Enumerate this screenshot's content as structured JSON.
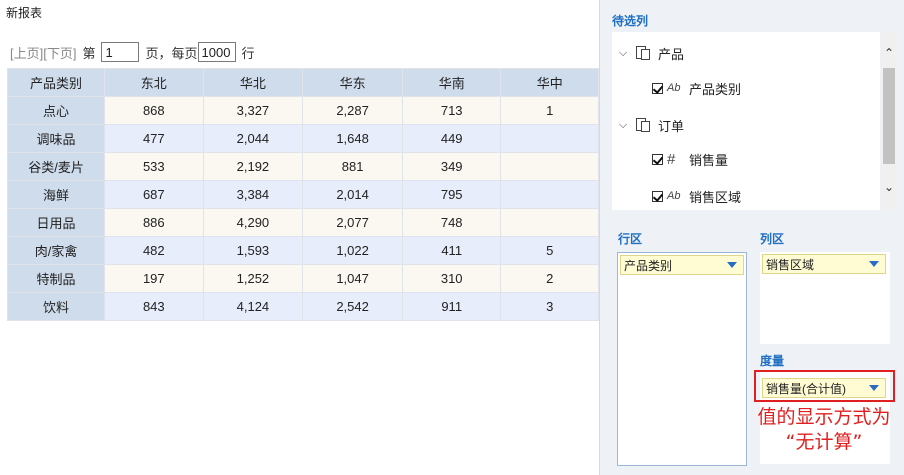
{
  "report": {
    "title": "新报表",
    "pager": {
      "prev": "[上页]",
      "next": "[下页]",
      "page_prefix": "第",
      "page_value": "1",
      "page_suffix": "页，每页",
      "size_value": "1000",
      "size_suffix": "行"
    },
    "table": {
      "columns": [
        "产品类别",
        "东北",
        "华北",
        "华东",
        "华南",
        "华中"
      ],
      "rows": [
        {
          "label": "点心",
          "values": [
            "868",
            "3,327",
            "2,287",
            "713",
            "1"
          ]
        },
        {
          "label": "调味品",
          "values": [
            "477",
            "2,044",
            "1,648",
            "449",
            ""
          ]
        },
        {
          "label": "谷类/麦片",
          "values": [
            "533",
            "2,192",
            "881",
            "349",
            ""
          ]
        },
        {
          "label": "海鲜",
          "values": [
            "687",
            "3,384",
            "2,014",
            "795",
            ""
          ]
        },
        {
          "label": "日用品",
          "values": [
            "886",
            "4,290",
            "2,077",
            "748",
            ""
          ]
        },
        {
          "label": "肉/家禽",
          "values": [
            "482",
            "1,593",
            "1,022",
            "411",
            "5"
          ]
        },
        {
          "label": "特制品",
          "values": [
            "197",
            "1,252",
            "1,047",
            "310",
            "2"
          ]
        },
        {
          "label": "饮料",
          "values": [
            "843",
            "4,124",
            "2,542",
            "911",
            "3"
          ]
        }
      ]
    }
  },
  "panel": {
    "candidates_title": "待选列",
    "tree": [
      {
        "kind": "folder",
        "label": "产品",
        "icon": "table-icon"
      },
      {
        "kind": "field",
        "type": "Ab",
        "label": "产品类别",
        "checked": true
      },
      {
        "kind": "folder",
        "label": "订单",
        "icon": "table-icon"
      },
      {
        "kind": "field",
        "type": "#",
        "label": "销售量",
        "checked": true
      },
      {
        "kind": "field",
        "type": "Ab",
        "label": "销售区域",
        "checked": true
      }
    ],
    "row_area": {
      "title": "行区",
      "item": "产品类别"
    },
    "col_area": {
      "title": "列区",
      "item": "销售区域"
    },
    "measure_area": {
      "title": "度量",
      "item": "销售量(合计值)"
    },
    "annotation_line1": "值的显示方式为",
    "annotation_line2": "“无计算”",
    "colors": {
      "accent": "#1f6fc4",
      "highlight": "#e02020",
      "header": "#cfdcec"
    }
  }
}
